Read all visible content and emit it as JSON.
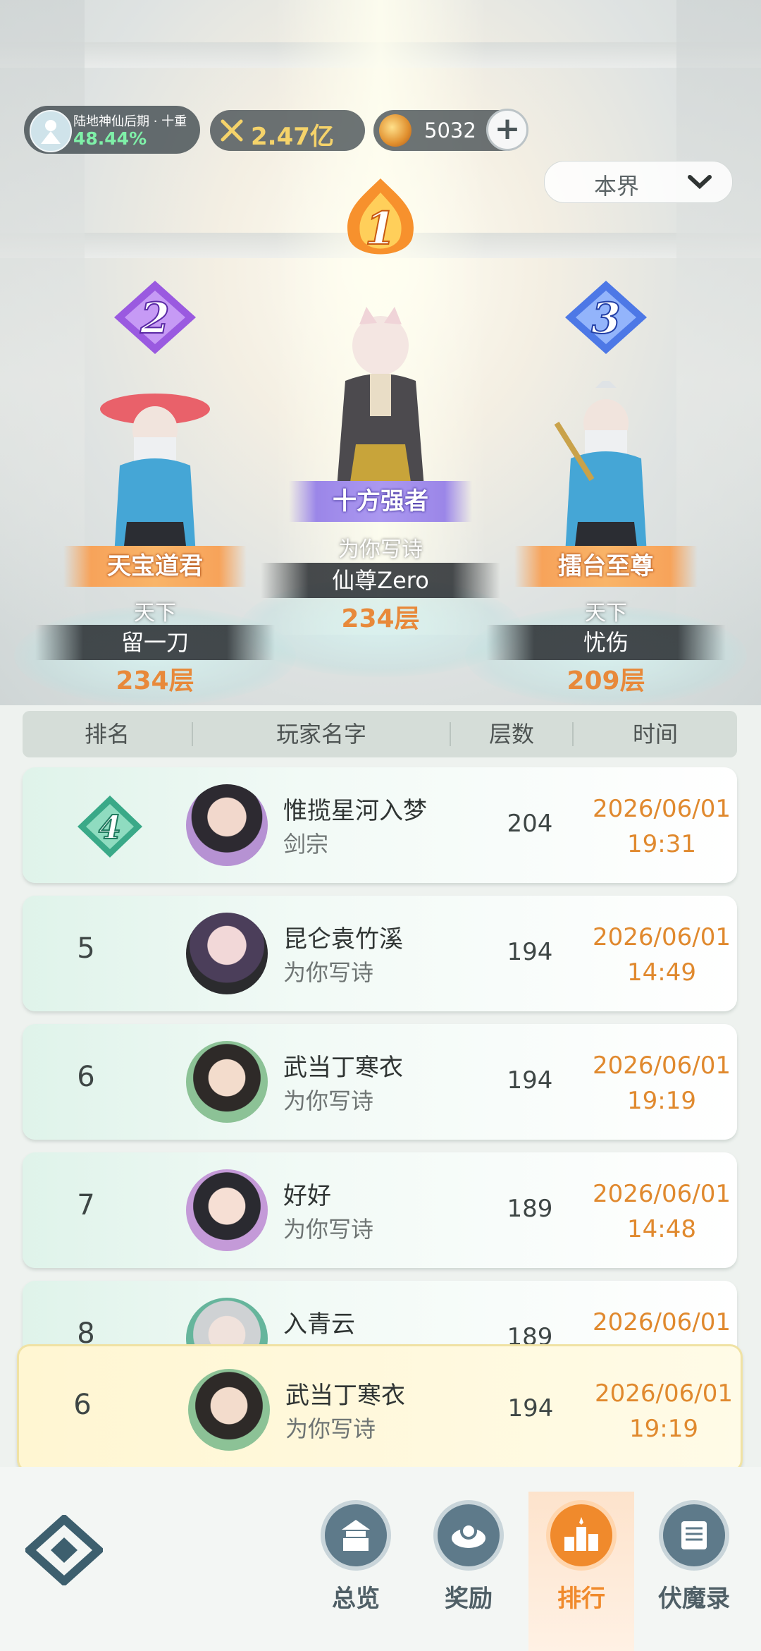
{
  "header": {
    "realm_name": "陆地神仙后期 · 十重",
    "realm_progress": "48.44%",
    "power": "2.47亿",
    "currency": "5032",
    "add_label": "+",
    "region_filter": "本界"
  },
  "podium": {
    "first": {
      "rank": "1",
      "title": "十方强者",
      "guild": "为你写诗",
      "name": "仙尊Zero",
      "floors": "234层"
    },
    "second": {
      "rank": "2",
      "title": "天宝道君",
      "guild": "天下",
      "name": "留一刀",
      "floors": "234层"
    },
    "third": {
      "rank": "3",
      "title": "擂台至尊",
      "guild": "天下",
      "name": "忧伤",
      "floors": "209层"
    }
  },
  "table": {
    "headers": {
      "rank": "排名",
      "player": "玩家名字",
      "floors": "层数",
      "time": "时间"
    },
    "rows": [
      {
        "rank": "4",
        "name": "惟揽星河入梦",
        "guild": "剑宗",
        "floors": "204",
        "date": "2026/06/01",
        "time": "19:31"
      },
      {
        "rank": "5",
        "name": "昆仑袁竹溪",
        "guild": "为你写诗",
        "floors": "194",
        "date": "2026/06/01",
        "time": "14:49"
      },
      {
        "rank": "6",
        "name": "武当丁寒衣",
        "guild": "为你写诗",
        "floors": "194",
        "date": "2026/06/01",
        "time": "19:19"
      },
      {
        "rank": "7",
        "name": "好好",
        "guild": "为你写诗",
        "floors": "189",
        "date": "2026/06/01",
        "time": "14:48"
      },
      {
        "rank": "8",
        "name": "入青云",
        "guild": "",
        "floors": "189",
        "date": "2026/06/01",
        "time": ""
      }
    ],
    "self": {
      "rank": "6",
      "name": "武当丁寒衣",
      "guild": "为你写诗",
      "floors": "194",
      "date": "2026/06/01",
      "time": "19:19"
    }
  },
  "nav": {
    "items": [
      {
        "label": "总览",
        "icon": "pagoda-icon"
      },
      {
        "label": "奖励",
        "icon": "reward-icon"
      },
      {
        "label": "排行",
        "icon": "ranking-icon"
      },
      {
        "label": "伏魔录",
        "icon": "scroll-icon"
      }
    ],
    "active": "排行"
  },
  "colors": {
    "accent": "#f08a2c",
    "date": "#e0892e",
    "realm_pct": "#7ff0a8"
  }
}
